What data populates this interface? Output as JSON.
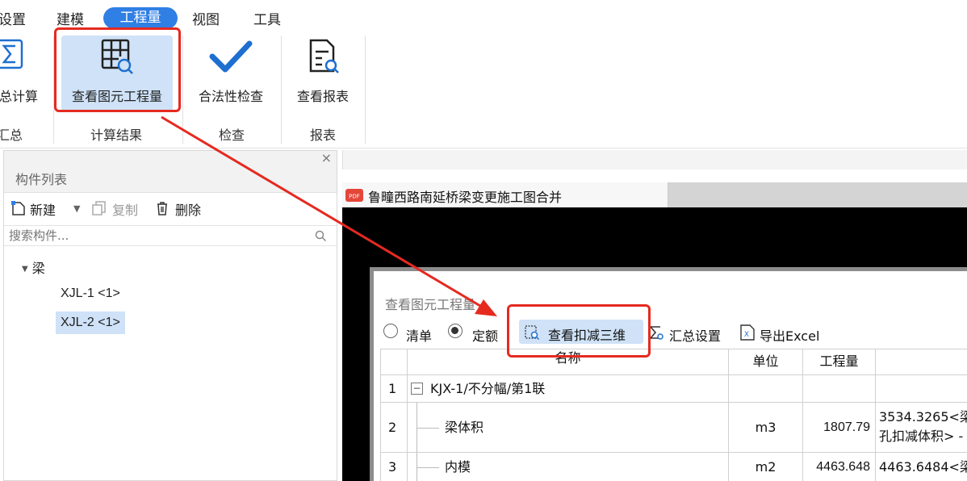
{
  "menubar": {
    "items": [
      "设置",
      "建模",
      "工程量",
      "视图",
      "工具"
    ],
    "active": "工程量"
  },
  "ribbon": {
    "buttons": {
      "summary": "总计算",
      "view_quantity": "查看图元工程量",
      "legality": "合法性检查",
      "report": "查看报表"
    },
    "groups": {
      "summary": "汇总",
      "calc_result": "计算结果",
      "check": "检查",
      "report": "报表"
    }
  },
  "left_panel": {
    "title": "构件列表",
    "close": "×",
    "toolbar": {
      "new": "新建",
      "copy": "复制",
      "delete": "删除"
    },
    "search_placeholder": "搜索构件...",
    "tree": {
      "root": "梁",
      "items": [
        "XJL-1 <1>",
        "XJL-2 <1>"
      ]
    }
  },
  "document_tab": {
    "label": "鲁疃西路南延桥梁变更施工图合并"
  },
  "dialog": {
    "title": "查看图元工程量",
    "options": {
      "list": "清单",
      "quota": "定额",
      "selected": "定额"
    },
    "buttons": {
      "deduct3d": "查看扣减三维",
      "summary_settings": "汇总设置",
      "export": "导出Excel"
    },
    "table": {
      "headers": [
        "",
        "名称",
        "单位",
        "工程量",
        ""
      ],
      "rows": [
        {
          "no": "1",
          "name": "KJX-1/不分幅/第1联",
          "unit": "",
          "qty": "",
          "expr": "",
          "expr2": ""
        },
        {
          "no": "2",
          "name": "梁体积",
          "unit": "m3",
          "qty": "1807.79",
          "expr": "3534.3265<梁",
          "expr2": "孔扣减体积> -"
        },
        {
          "no": "3",
          "name": "内模",
          "unit": "m2",
          "qty": "4463.648",
          "expr": "4463.6484<梁",
          "expr2": ""
        }
      ]
    }
  },
  "colors": {
    "accent": "#2f7fe5",
    "annotation_red": "#e52a20",
    "selection": "#cfe2f7"
  }
}
